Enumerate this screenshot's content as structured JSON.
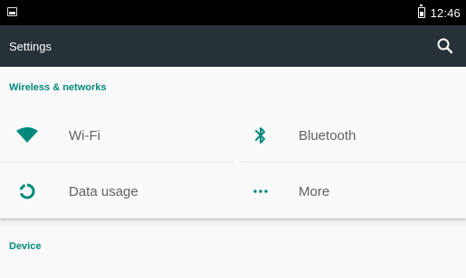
{
  "status_bar": {
    "time": "12:46",
    "icons": [
      "notification-icon",
      "battery-icon"
    ]
  },
  "app_bar": {
    "title": "Settings",
    "search_icon": "search-icon"
  },
  "sections": {
    "wireless": {
      "header": "Wireless & networks",
      "tiles": [
        {
          "label": "Wi-Fi",
          "icon": "wifi-icon"
        },
        {
          "label": "Bluetooth",
          "icon": "bluetooth-icon"
        },
        {
          "label": "Data usage",
          "icon": "data-usage-icon"
        },
        {
          "label": "More",
          "icon": "more-icon"
        }
      ]
    },
    "device": {
      "header": "Device"
    }
  },
  "colors": {
    "accent": "#00897b",
    "app_bar": "#263238",
    "status_bar": "#000000"
  }
}
